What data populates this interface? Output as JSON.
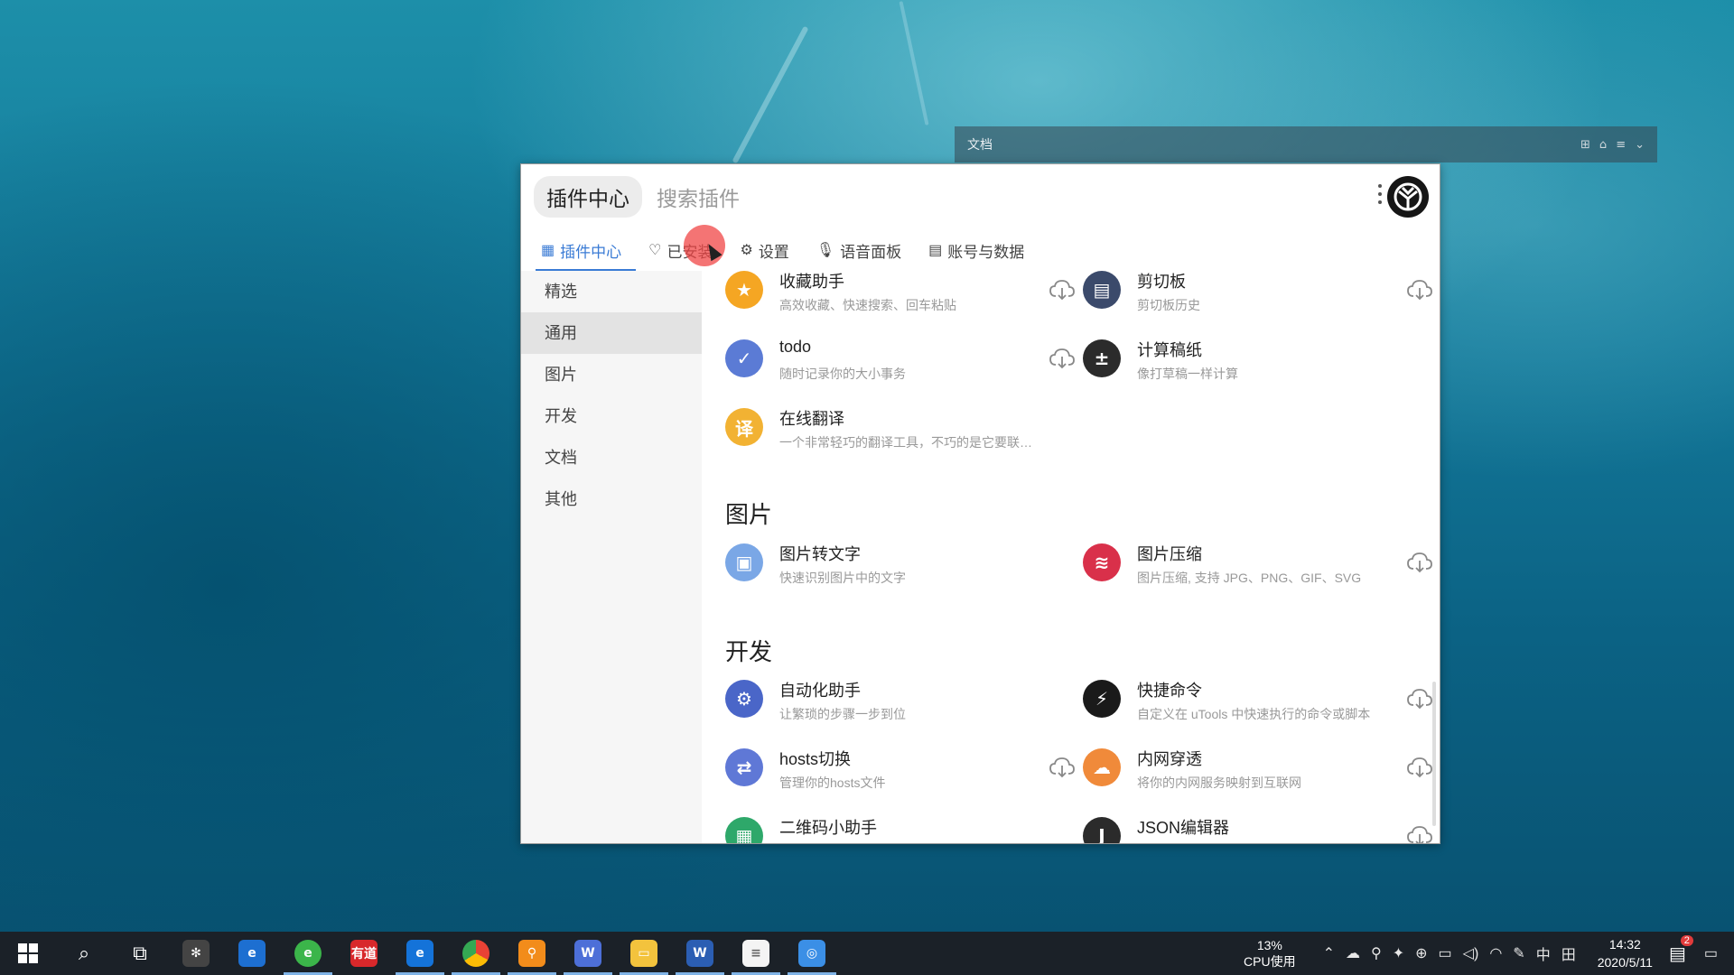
{
  "background_window": {
    "title": "文档"
  },
  "window": {
    "tab_pill": "插件中心",
    "search_placeholder": "搜索插件",
    "tabs": [
      {
        "label": "插件中心",
        "icon": "grid-icon"
      },
      {
        "label": "已安装",
        "icon": "heart-icon"
      },
      {
        "label": "设置",
        "icon": "gear-icon"
      },
      {
        "label": "语音面板",
        "icon": "mic-icon"
      },
      {
        "label": "账号与数据",
        "icon": "doc-icon"
      }
    ],
    "sidebar": [
      "精选",
      "通用",
      "图片",
      "开发",
      "文档",
      "其他"
    ],
    "sections": {
      "images": "图片",
      "dev": "开发"
    },
    "plugins": [
      {
        "name": "收藏助手",
        "desc": "高效收藏、快速搜索、回车粘贴",
        "color": "#f5a623",
        "glyph": "★"
      },
      {
        "name": "剪切板",
        "desc": "剪切板历史",
        "color": "#3b4a6b",
        "glyph": "▤"
      },
      {
        "name": "todo",
        "desc": "随时记录你的大小事务",
        "color": "#5b7bd5",
        "glyph": "✓"
      },
      {
        "name": "计算稿纸",
        "desc": "像打草稿一样计算",
        "color": "#2b2b2b",
        "glyph": "±"
      },
      {
        "name": "在线翻译",
        "desc": "一个非常轻巧的翻译工具，不巧的是它要联网使用",
        "color": "#f2b233",
        "glyph": "译"
      },
      {
        "name": "图片转文字",
        "desc": "快速识别图片中的文字",
        "color": "#7aa7e6",
        "glyph": "▣"
      },
      {
        "name": "图片压缩",
        "desc": "图片压缩, 支持 JPG、PNG、GIF、SVG",
        "color": "#d9304a",
        "glyph": "≋"
      },
      {
        "name": "自动化助手",
        "desc": "让繁琐的步骤一步到位",
        "color": "#4a66c8",
        "glyph": "⚙"
      },
      {
        "name": "快捷命令",
        "desc": "自定义在 uTools 中快速执行的命令或脚本",
        "color": "#1a1a1a",
        "glyph": "⚡"
      },
      {
        "name": "hosts切换",
        "desc": "管理你的hosts文件",
        "color": "#5f78d6",
        "glyph": "⇄"
      },
      {
        "name": "内网穿透",
        "desc": "将你的内网服务映射到互联网",
        "color": "#f08a3a",
        "glyph": "☁"
      },
      {
        "name": "二维码小助手",
        "desc": "",
        "color": "#2ea86a",
        "glyph": "▦"
      },
      {
        "name": "JSON编辑器",
        "desc": "",
        "color": "#2b2b2b",
        "glyph": "J"
      }
    ]
  },
  "taskbar": {
    "cpu_percent": "13%",
    "cpu_label": "CPU使用",
    "ime": "中",
    "time": "14:32",
    "date": "2020/5/11",
    "notifications": "2"
  }
}
